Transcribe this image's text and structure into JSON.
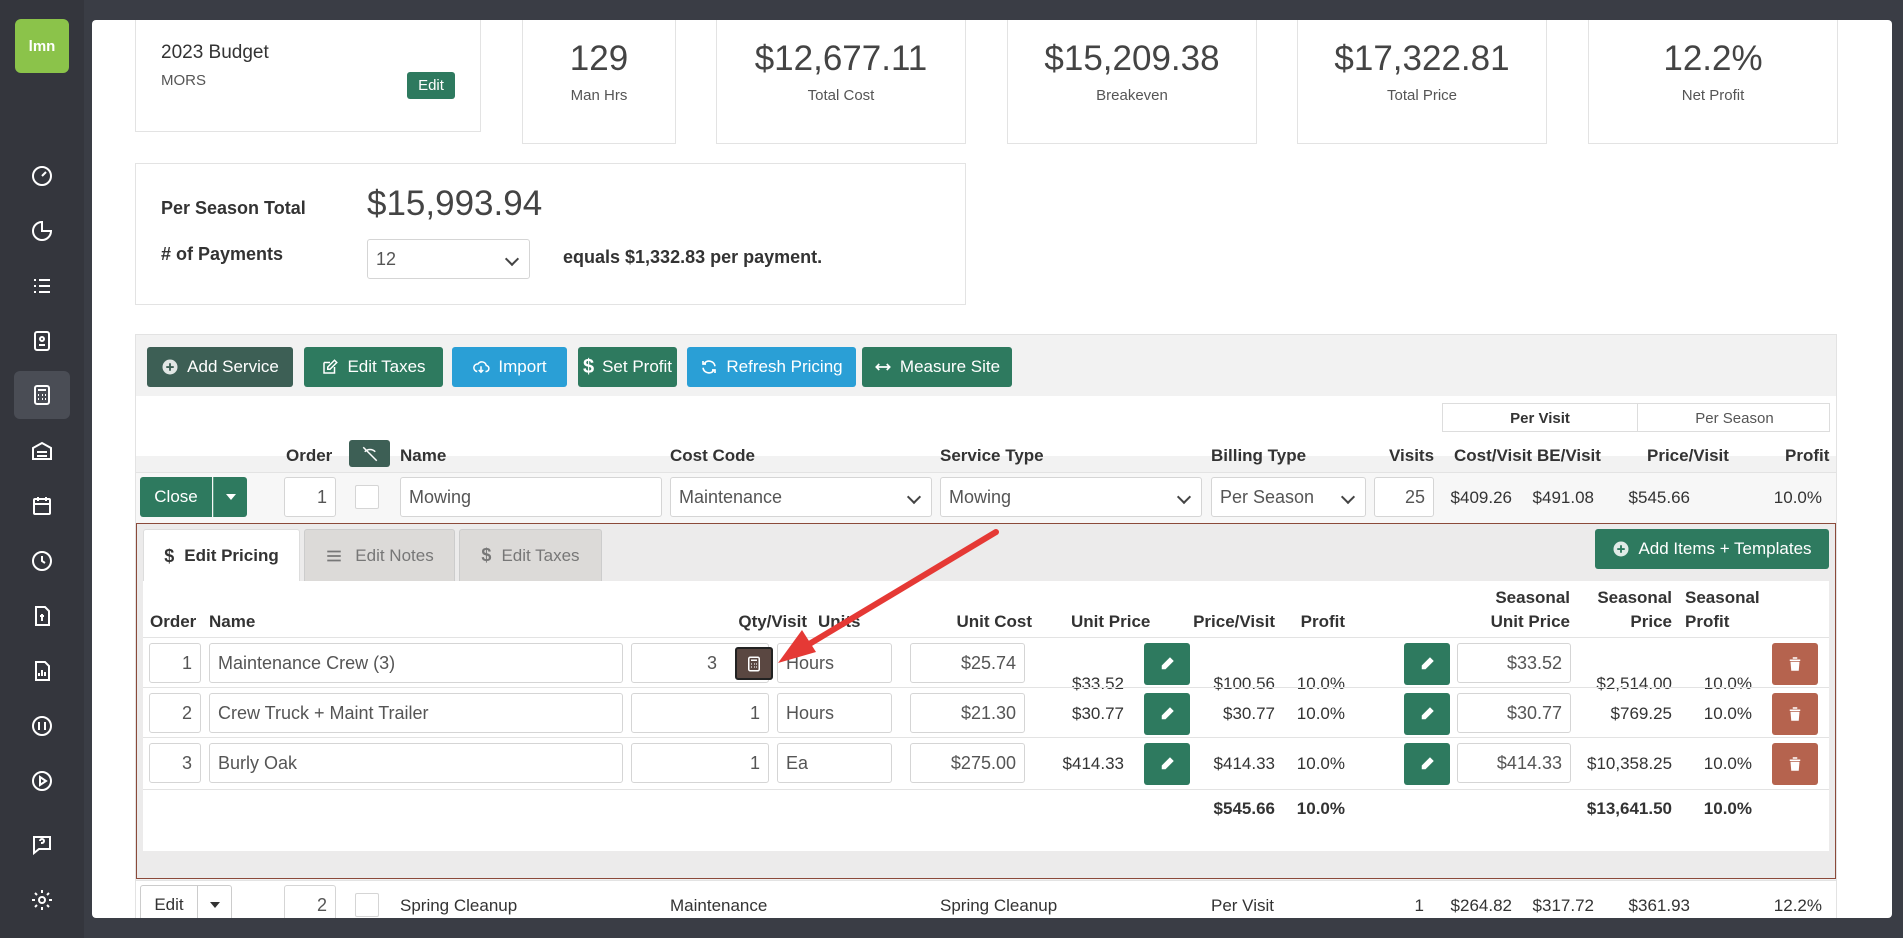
{
  "logo": "lmn",
  "budget": {
    "title": "2023 Budget",
    "subtitle": "MORS",
    "edit_label": "Edit"
  },
  "stats": [
    {
      "value": "129",
      "label": "Man Hrs"
    },
    {
      "value": "$12,677.11",
      "label": "Total Cost"
    },
    {
      "value": "$15,209.38",
      "label": "Breakeven"
    },
    {
      "value": "$17,322.81",
      "label": "Total Price"
    },
    {
      "value": "12.2%",
      "label": "Net Profit"
    }
  ],
  "season": {
    "total_label": "Per Season Total",
    "total_value": "$15,993.94",
    "payments_label": "# of Payments",
    "payments_value": "12",
    "equals_text": "equals $1,332.83 per payment."
  },
  "toolbar": {
    "add_service": "Add Service",
    "edit_taxes": "Edit Taxes",
    "import": "Import",
    "set_profit": "Set Profit",
    "refresh_pricing": "Refresh Pricing",
    "measure_site": "Measure Site"
  },
  "view_toggle": {
    "per_visit": "Per Visit",
    "per_season": "Per Season"
  },
  "services_header": {
    "order": "Order",
    "name": "Name",
    "cost_code": "Cost Code",
    "service_type": "Service Type",
    "billing_type": "Billing Type",
    "visits": "Visits",
    "cost_visit": "Cost/Visit",
    "be_visit": "BE/Visit",
    "price_visit": "Price/Visit",
    "profit": "Profit"
  },
  "service1": {
    "action": "Close",
    "order": "1",
    "name": "Mowing",
    "cost_code": "Maintenance",
    "service_type": "Mowing",
    "billing_type": "Per Season",
    "visits": "25",
    "cost_visit": "$409.26",
    "be_visit": "$491.08",
    "price_visit": "$545.66",
    "profit": "10.0%"
  },
  "tabs": {
    "edit_pricing": "Edit Pricing",
    "edit_notes": "Edit Notes",
    "edit_taxes": "Edit Taxes",
    "add_items": "Add Items + Templates"
  },
  "items_header": {
    "order": "Order",
    "name": "Name",
    "qty_visit": "Qty/Visit",
    "units": "Units",
    "unit_cost": "Unit Cost",
    "unit_price": "Unit Price",
    "price_visit": "Price/Visit",
    "profit": "Profit",
    "seasonal_unit_price_1": "Seasonal",
    "seasonal_unit_price_2": "Unit Price",
    "seasonal_price_1": "Seasonal",
    "seasonal_price_2": "Price",
    "seasonal_profit_1": "Seasonal",
    "seasonal_profit_2": "Profit"
  },
  "items": [
    {
      "order": "1",
      "name": "Maintenance Crew (3)",
      "qty": "3",
      "units": "Hours",
      "unit_cost": "$25.74",
      "unit_price": "$33.52",
      "price_visit": "$100.56",
      "profit": "10.0%",
      "seasonal_unit_price": "$33.52",
      "seasonal_price": "$2,514.00",
      "seasonal_profit": "10.0%"
    },
    {
      "order": "2",
      "name": "Crew Truck + Maint Trailer",
      "qty": "1",
      "units": "Hours",
      "unit_cost": "$21.30",
      "unit_price": "$30.77",
      "price_visit": "$30.77",
      "profit": "10.0%",
      "seasonal_unit_price": "$30.77",
      "seasonal_price": "$769.25",
      "seasonal_profit": "10.0%"
    },
    {
      "order": "3",
      "name": "Burly Oak",
      "qty": "1",
      "units": "Ea",
      "unit_cost": "$275.00",
      "unit_price": "$414.33",
      "price_visit": "$414.33",
      "profit": "10.0%",
      "seasonal_unit_price": "$414.33",
      "seasonal_price": "$10,358.25",
      "seasonal_profit": "10.0%"
    }
  ],
  "totals": {
    "price_visit": "$545.66",
    "profit": "10.0%",
    "seasonal_price": "$13,641.50",
    "seasonal_profit": "10.0%"
  },
  "service2": {
    "action": "Edit",
    "order": "2",
    "name": "Spring Cleanup",
    "cost_code": "Maintenance",
    "service_type": "Spring Cleanup",
    "billing_type": "Per Visit",
    "visits": "1",
    "cost_visit": "$264.82",
    "be_visit": "$317.72",
    "price_visit": "$361.93",
    "profit": "12.2%"
  },
  "colors": {
    "primary_green": "#2e7a5f",
    "blue": "#2a9fd6",
    "rust": "#b5634e",
    "arrow": "#e53935"
  }
}
